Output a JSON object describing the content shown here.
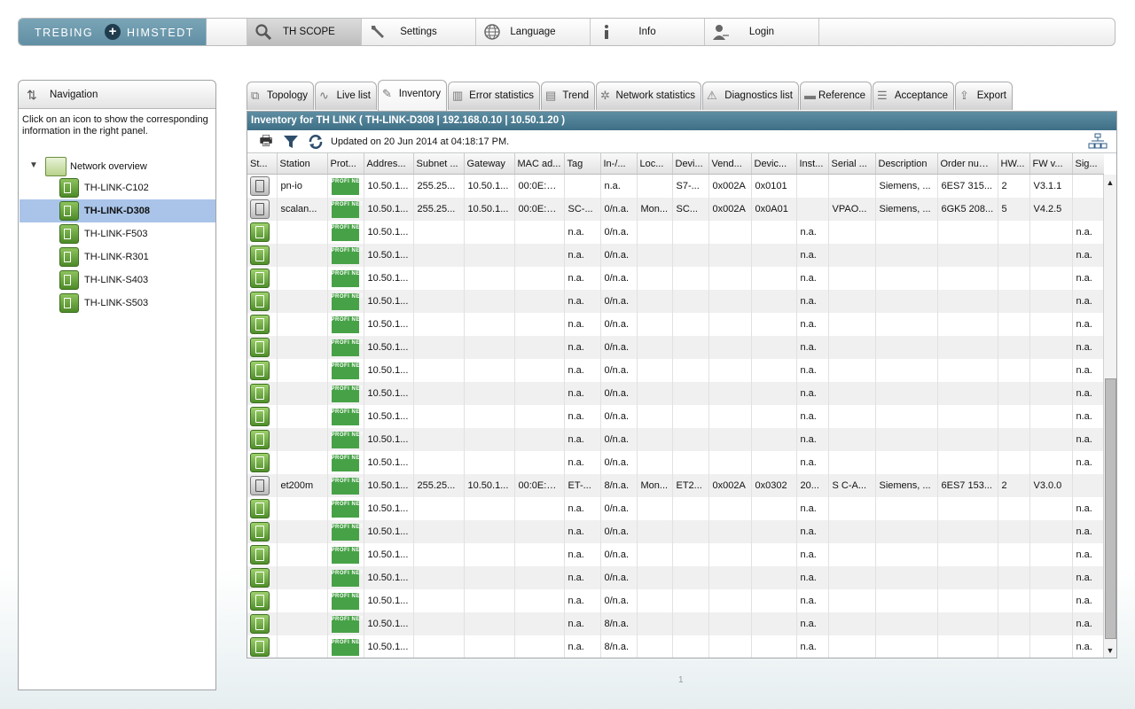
{
  "brand": {
    "left": "TREBING",
    "right": "HIMSTEDT",
    "plus": "+"
  },
  "menu": [
    {
      "label": "TH SCOPE",
      "icon": "magnifier-icon"
    },
    {
      "label": "Settings",
      "icon": "wrench-icon"
    },
    {
      "label": "Language",
      "icon": "globe-icon"
    },
    {
      "label": "Info",
      "icon": "info-icon"
    },
    {
      "label": "Login",
      "icon": "user-key-icon"
    }
  ],
  "nav": {
    "title": "Navigation",
    "hint": "Click on an icon to show the corresponding information in the right panel.",
    "root": "Network overview",
    "items": [
      "TH-LINK-C102",
      "TH-LINK-D308",
      "TH-LINK-F503",
      "TH-LINK-R301",
      "TH-LINK-S403",
      "TH-LINK-S503"
    ],
    "selected": "TH-LINK-D308"
  },
  "tabs": [
    {
      "label": "Topology",
      "icon": "topology-icon"
    },
    {
      "label": "Live list",
      "icon": "pulse-icon"
    },
    {
      "label": "Inventory",
      "icon": "inventory-icon"
    },
    {
      "label": "Error statistics",
      "icon": "bar-chart-icon"
    },
    {
      "label": "Trend",
      "icon": "trend-icon"
    },
    {
      "label": "Network statistics",
      "icon": "network-icon"
    },
    {
      "label": "Diagnostics list",
      "icon": "warning-icon"
    },
    {
      "label": "Reference",
      "icon": "reference-icon"
    },
    {
      "label": "Acceptance",
      "icon": "document-icon"
    },
    {
      "label": "Export",
      "icon": "export-icon"
    }
  ],
  "active_tab": "Inventory",
  "panel": {
    "title": "Inventory for TH LINK  ( TH-LINK-D308 | 192.168.0.10 | 10.50.1.20 )",
    "updated": "Updated on 20 Jun 2014 at 04:18:17 PM."
  },
  "columns": [
    "St...",
    "Station",
    "Prot...",
    "Addres...",
    "Subnet ...",
    "Gateway",
    "MAC ad...",
    "Tag",
    "In-/...",
    "Loc...",
    "Devi...",
    "Vend...",
    "Devic...",
    "Inst...",
    "Serial ...",
    "Description",
    "Order num...",
    "HW...",
    "FW v...",
    "Sig..."
  ],
  "protocol_label": "PROFI NET",
  "rows": [
    [
      "gray",
      "pn-io",
      "",
      "10.50.1...",
      "255.25...",
      "10.50.1...",
      "00:0E:8...",
      "",
      "n.a.",
      "",
      "S7-...",
      "0x002A",
      "0x0101",
      "",
      "",
      "Siemens, ...",
      "6ES7 315...",
      "2",
      "V3.1.1",
      ""
    ],
    [
      "gray",
      "scalan...",
      "",
      "10.50.1...",
      "255.25...",
      "10.50.1...",
      "00:0E:8...",
      "SC-...",
      "0/n.a.",
      "Mon...",
      "SC...",
      "0x002A",
      "0x0A01",
      "",
      "VPAO...",
      "Siemens, ...",
      "6GK5 208...",
      "5",
      "V4.2.5",
      ""
    ],
    [
      "green",
      "",
      "",
      "10.50.1...",
      "",
      "",
      "",
      "n.a.",
      "0/n.a.",
      "",
      "",
      "",
      "",
      "n.a.",
      "",
      "",
      "",
      "",
      "",
      "n.a."
    ],
    [
      "green",
      "",
      "",
      "10.50.1...",
      "",
      "",
      "",
      "n.a.",
      "0/n.a.",
      "",
      "",
      "",
      "",
      "n.a.",
      "",
      "",
      "",
      "",
      "",
      "n.a."
    ],
    [
      "green",
      "",
      "",
      "10.50.1...",
      "",
      "",
      "",
      "n.a.",
      "0/n.a.",
      "",
      "",
      "",
      "",
      "n.a.",
      "",
      "",
      "",
      "",
      "",
      "n.a."
    ],
    [
      "green",
      "",
      "",
      "10.50.1...",
      "",
      "",
      "",
      "n.a.",
      "0/n.a.",
      "",
      "",
      "",
      "",
      "n.a.",
      "",
      "",
      "",
      "",
      "",
      "n.a."
    ],
    [
      "green",
      "",
      "",
      "10.50.1...",
      "",
      "",
      "",
      "n.a.",
      "0/n.a.",
      "",
      "",
      "",
      "",
      "n.a.",
      "",
      "",
      "",
      "",
      "",
      "n.a."
    ],
    [
      "green",
      "",
      "",
      "10.50.1...",
      "",
      "",
      "",
      "n.a.",
      "0/n.a.",
      "",
      "",
      "",
      "",
      "n.a.",
      "",
      "",
      "",
      "",
      "",
      "n.a."
    ],
    [
      "green",
      "",
      "",
      "10.50.1...",
      "",
      "",
      "",
      "n.a.",
      "0/n.a.",
      "",
      "",
      "",
      "",
      "n.a.",
      "",
      "",
      "",
      "",
      "",
      "n.a."
    ],
    [
      "green",
      "",
      "",
      "10.50.1...",
      "",
      "",
      "",
      "n.a.",
      "0/n.a.",
      "",
      "",
      "",
      "",
      "n.a.",
      "",
      "",
      "",
      "",
      "",
      "n.a."
    ],
    [
      "green",
      "",
      "",
      "10.50.1...",
      "",
      "",
      "",
      "n.a.",
      "0/n.a.",
      "",
      "",
      "",
      "",
      "n.a.",
      "",
      "",
      "",
      "",
      "",
      "n.a."
    ],
    [
      "green",
      "",
      "",
      "10.50.1...",
      "",
      "",
      "",
      "n.a.",
      "0/n.a.",
      "",
      "",
      "",
      "",
      "n.a.",
      "",
      "",
      "",
      "",
      "",
      "n.a."
    ],
    [
      "green",
      "",
      "",
      "10.50.1...",
      "",
      "",
      "",
      "n.a.",
      "0/n.a.",
      "",
      "",
      "",
      "",
      "n.a.",
      "",
      "",
      "",
      "",
      "",
      "n.a."
    ],
    [
      "gray",
      "et200m",
      "",
      "10.50.1...",
      "255.25...",
      "10.50.1...",
      "00:0E:8...",
      "ET-...",
      "8/n.a.",
      "Mon...",
      "ET2...",
      "0x002A",
      "0x0302",
      "20...",
      "S C-A...",
      "Siemens, ...",
      "6ES7 153...",
      "2",
      "V3.0.0",
      ""
    ],
    [
      "green",
      "",
      "",
      "10.50.1...",
      "",
      "",
      "",
      "n.a.",
      "0/n.a.",
      "",
      "",
      "",
      "",
      "n.a.",
      "",
      "",
      "",
      "",
      "",
      "n.a."
    ],
    [
      "green",
      "",
      "",
      "10.50.1...",
      "",
      "",
      "",
      "n.a.",
      "0/n.a.",
      "",
      "",
      "",
      "",
      "n.a.",
      "",
      "",
      "",
      "",
      "",
      "n.a."
    ],
    [
      "green",
      "",
      "",
      "10.50.1...",
      "",
      "",
      "",
      "n.a.",
      "0/n.a.",
      "",
      "",
      "",
      "",
      "n.a.",
      "",
      "",
      "",
      "",
      "",
      "n.a."
    ],
    [
      "green",
      "",
      "",
      "10.50.1...",
      "",
      "",
      "",
      "n.a.",
      "0/n.a.",
      "",
      "",
      "",
      "",
      "n.a.",
      "",
      "",
      "",
      "",
      "",
      "n.a."
    ],
    [
      "green",
      "",
      "",
      "10.50.1...",
      "",
      "",
      "",
      "n.a.",
      "0/n.a.",
      "",
      "",
      "",
      "",
      "n.a.",
      "",
      "",
      "",
      "",
      "",
      "n.a."
    ],
    [
      "green",
      "",
      "",
      "10.50.1...",
      "",
      "",
      "",
      "n.a.",
      "8/n.a.",
      "",
      "",
      "",
      "",
      "n.a.",
      "",
      "",
      "",
      "",
      "",
      "n.a."
    ],
    [
      "green",
      "",
      "",
      "10.50.1...",
      "",
      "",
      "",
      "n.a.",
      "8/n.a.",
      "",
      "",
      "",
      "",
      "n.a.",
      "",
      "",
      "",
      "",
      "",
      "n.a."
    ]
  ],
  "pager": "1",
  "colors": {
    "title_bar": "#4a7b90",
    "selected": "#a9c4e8",
    "status_green": "#5fa235",
    "profinet": "#47a247"
  }
}
